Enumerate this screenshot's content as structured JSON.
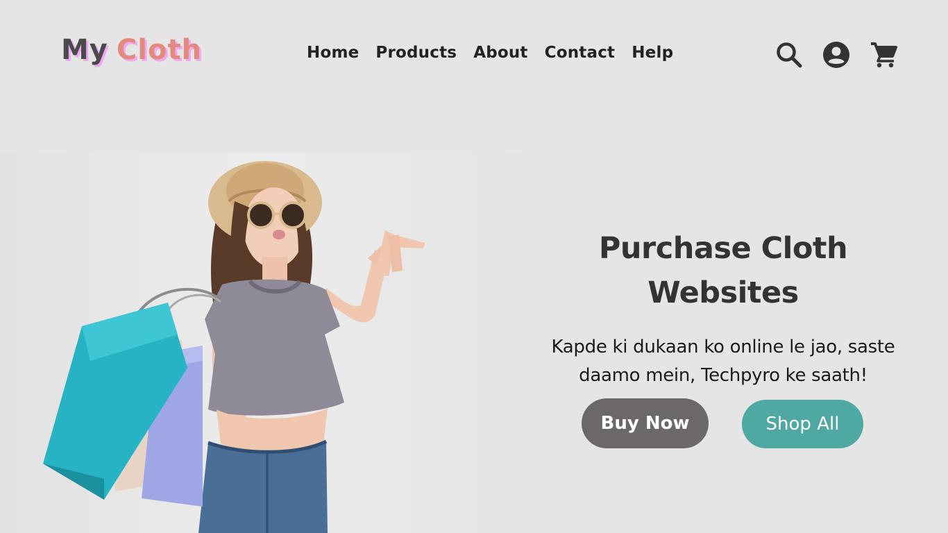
{
  "brand": {
    "logo_part_1": "My",
    "logo_part_2": "Cloth",
    "colors": {
      "logo_dark": "#4a4a4a",
      "logo_accent": "#e38a7e",
      "logo_shadow": "#f0a8f0"
    }
  },
  "nav": {
    "items": [
      {
        "label": "Home"
      },
      {
        "label": "Products"
      },
      {
        "label": "About"
      },
      {
        "label": "Contact"
      },
      {
        "label": "Help"
      }
    ]
  },
  "header_icons": [
    "search-icon",
    "account-circle-icon",
    "shopping-cart-icon"
  ],
  "hero": {
    "image_subject": "woman-with-shopping-bags",
    "title": "Purchase Cloth Websites",
    "subtitle": "Kapde ki dukaan ko online le jao, saste daamo mein, Techpyro ke saath!",
    "buttons": {
      "primary_label": "Buy Now",
      "secondary_label": "Shop All"
    }
  },
  "colors": {
    "page_background": "#e5e5e5",
    "buy_button": "#6b6867",
    "shop_button": "#4fa8a2",
    "text_dark": "#333333"
  }
}
